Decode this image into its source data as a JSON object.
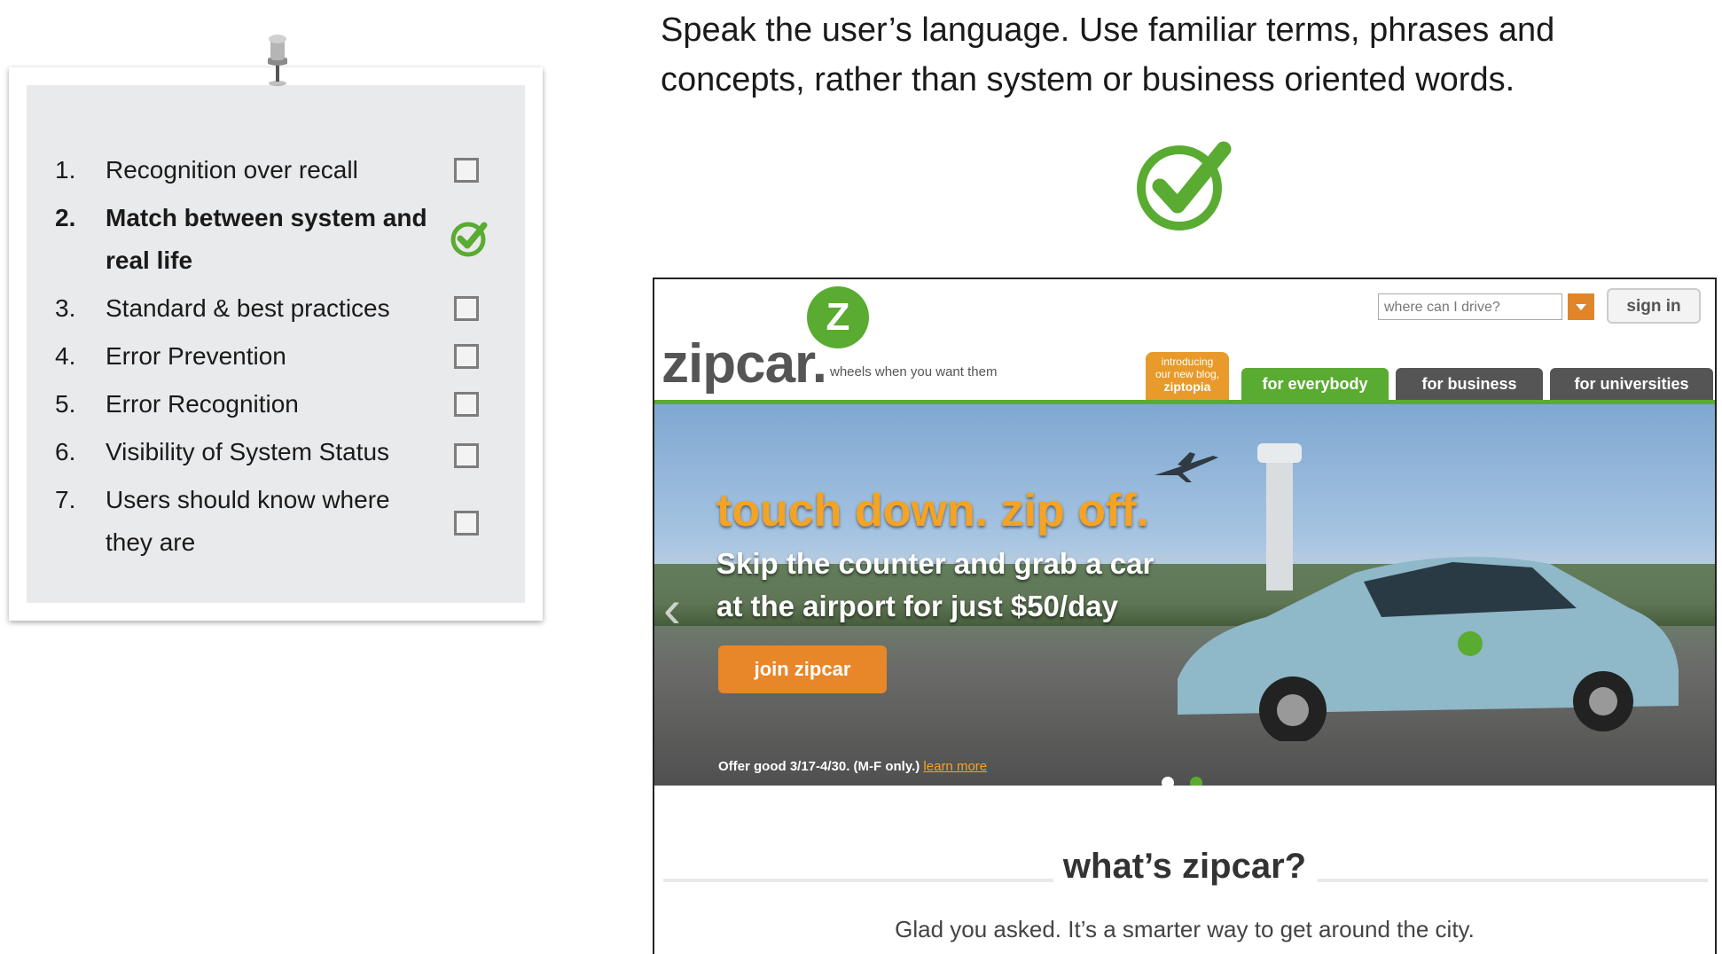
{
  "checklist": {
    "items": [
      {
        "num": "1.",
        "text": "Recognition over recall",
        "checked": false,
        "active": false
      },
      {
        "num": "2.",
        "text": "Match between system and real life",
        "checked": true,
        "active": true
      },
      {
        "num": "3.",
        "text": "Standard & best practices",
        "checked": false,
        "active": false
      },
      {
        "num": "4.",
        "text": "Error Prevention",
        "checked": false,
        "active": false
      },
      {
        "num": "5.",
        "text": "Error Recognition",
        "checked": false,
        "active": false
      },
      {
        "num": "6.",
        "text": "Visibility of System Status",
        "checked": false,
        "active": false
      },
      {
        "num": "7.",
        "text": "Users should know where they are",
        "checked": false,
        "active": false
      }
    ]
  },
  "heading": "Speak the user’s language. Use familiar terms, phrases and concepts, rather than system or business oriented words.",
  "colors": {
    "check_green": "#5aab31",
    "card_bg": "#e9eaeb",
    "zipcar_orange": "#e8862a"
  },
  "zipcar": {
    "logo": "zipcar.",
    "badge_letter": "Z",
    "tagline": "wheels when you want them",
    "search_placeholder": "where can I drive?",
    "signin": "sign in",
    "ziptopia": {
      "line1": "introducing",
      "line2": "our new blog,",
      "line3": "ziptopia"
    },
    "tabs": [
      "for everybody",
      "for business",
      "for universities"
    ],
    "hero": {
      "title": "touch down. zip off.",
      "line1": "Skip the counter and grab a car",
      "line2": "at the airport for just $50/day",
      "button": "join zipcar",
      "offer": "Offer good 3/17-4/30. (M-F only.)",
      "learn_more": "learn more"
    },
    "what_title": "what’s zipcar?",
    "what_text": "Glad you asked. It’s a smarter way to get around the city."
  }
}
